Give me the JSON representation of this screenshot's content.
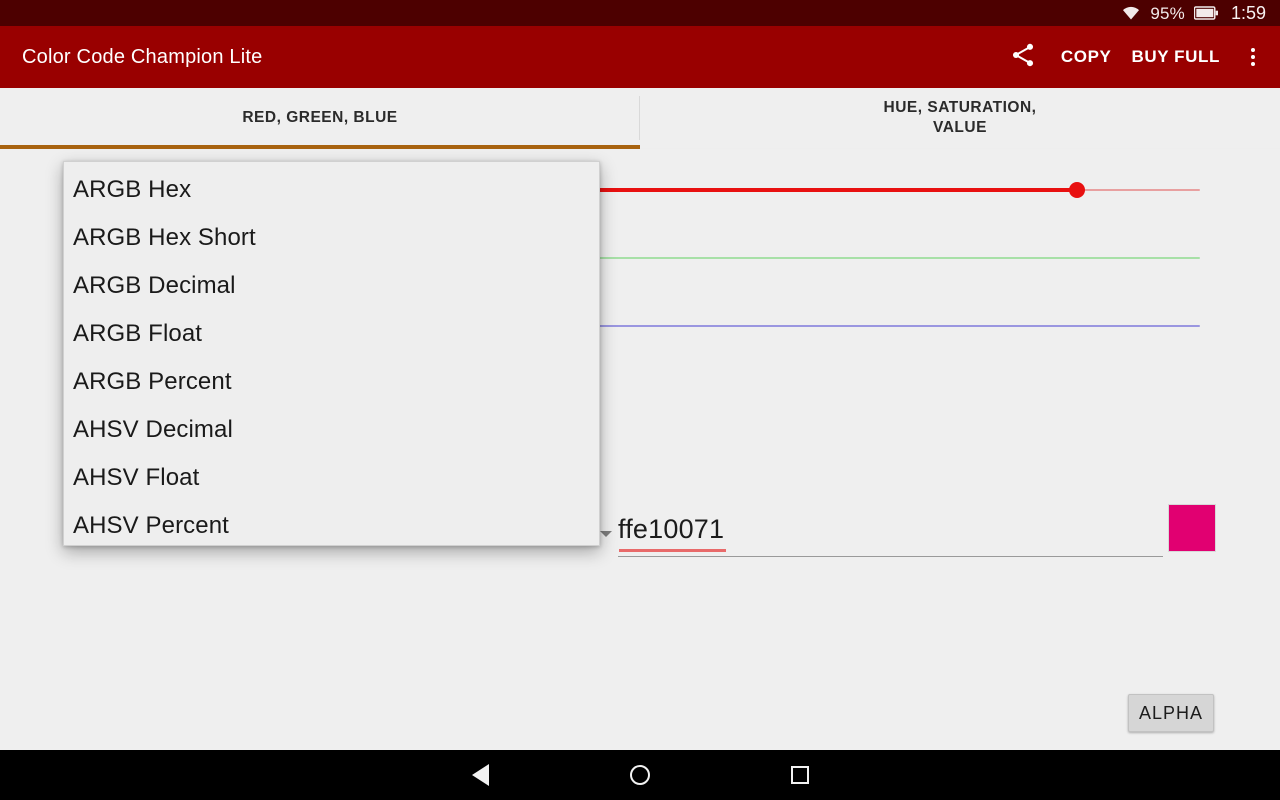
{
  "status_bar": {
    "wifi_icon": "wifi-icon",
    "battery_percent": "95%",
    "battery_icon": "battery-icon",
    "time": "1:59",
    "background_color": "#4d0000"
  },
  "app_bar": {
    "title": "Color Code Champion Lite",
    "background_color": "#990000",
    "share_icon": "share-icon",
    "copy_label": "COPY",
    "buy_full_label": "BUY FULL",
    "overflow_icon": "overflow-menu-icon"
  },
  "tabs": {
    "indicator_color": "#a8630f",
    "items": [
      {
        "label": "RED, GREEN, BLUE",
        "selected": true
      },
      {
        "label": "HUE, SATURATION,\nVALUE",
        "selected": false
      }
    ]
  },
  "sliders": [
    {
      "name": "red",
      "track_color": "#e8a0a0",
      "fill_color": "#e81010",
      "thumb_color": "#e81010",
      "thumb_percent": 89
    },
    {
      "name": "green",
      "track_color": "#a7e0a7",
      "fill_color": "#17a317",
      "thumb_color": "#17a317",
      "thumb_percent": 0
    },
    {
      "name": "blue",
      "track_color": "#9a96e0",
      "fill_color": "#1a13dd",
      "thumb_color": "#1a13dd",
      "thumb_percent": 3
    }
  ],
  "format_row": {
    "spinner_arrow_icon": "chevron-down-icon",
    "hex_value": "ffe10071",
    "swatch_color": "#e10071"
  },
  "alpha_button": {
    "label": "ALPHA"
  },
  "dropdown": {
    "items": [
      {
        "label": "ARGB Hex"
      },
      {
        "label": "ARGB Hex Short"
      },
      {
        "label": "ARGB Decimal"
      },
      {
        "label": "ARGB Float"
      },
      {
        "label": "ARGB Percent"
      },
      {
        "label": "AHSV Decimal"
      },
      {
        "label": "AHSV Float"
      },
      {
        "label": "AHSV Percent"
      }
    ]
  },
  "nav_bar": {
    "back_icon": "back-triangle-icon",
    "home_icon": "home-circle-icon",
    "recents_icon": "recents-square-icon"
  }
}
